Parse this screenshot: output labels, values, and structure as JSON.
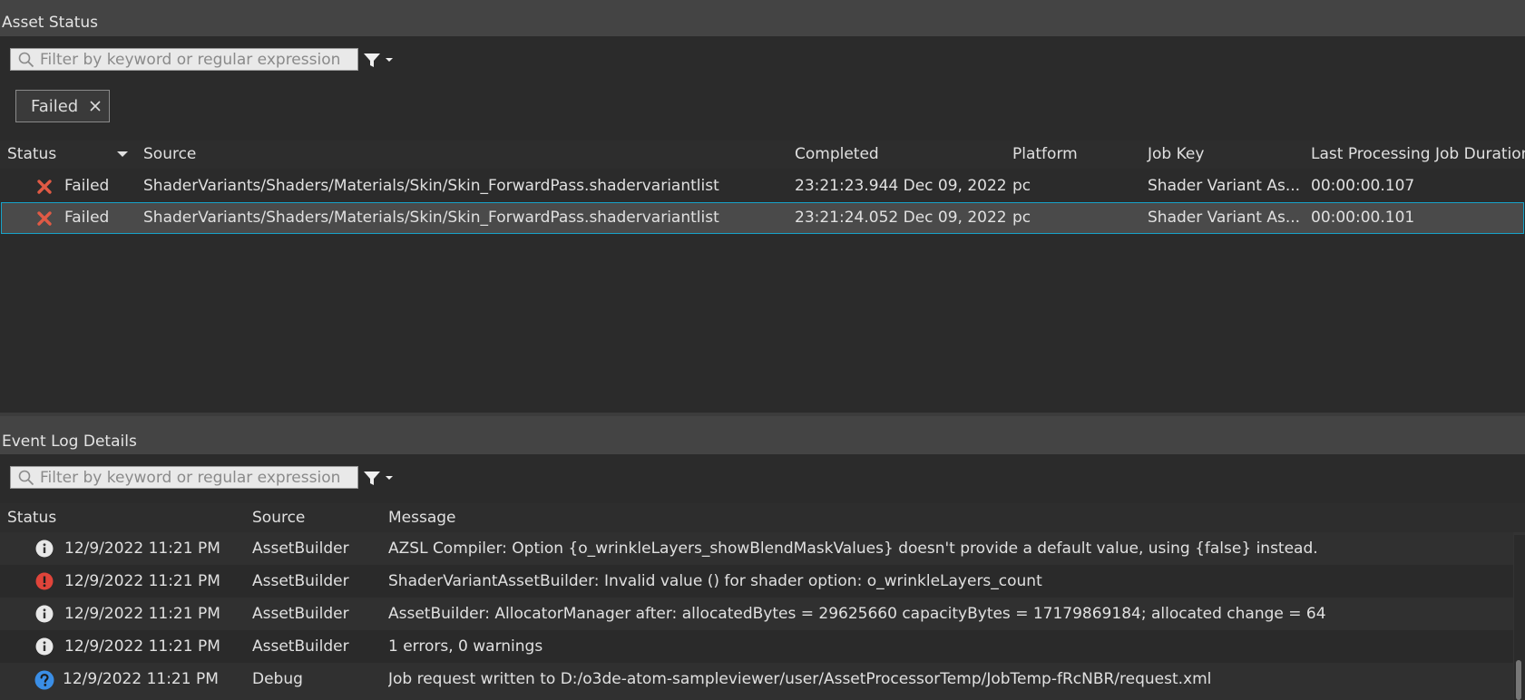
{
  "asset_status": {
    "title": "Asset Status",
    "search_placeholder": "Filter by keyword or regular expression",
    "filter_chip": "Failed",
    "columns": [
      "Status",
      "Source",
      "Completed",
      "Platform",
      "Job Key",
      "Last Processing Job Duration"
    ],
    "rows": [
      {
        "status": "Failed",
        "source": "ShaderVariants/Shaders/Materials/Skin/Skin_ForwardPass.shadervariantlist",
        "completed": "23:21:23.944 Dec 09, 2022",
        "platform": "pc",
        "job_key": "Shader Variant As...",
        "duration": "00:00:00.107"
      },
      {
        "status": "Failed",
        "source": "ShaderVariants/Shaders/Materials/Skin/Skin_ForwardPass.shadervariantlist",
        "completed": "23:21:24.052 Dec 09, 2022",
        "platform": "pc",
        "job_key": "Shader Variant As...",
        "duration": "00:00:00.101"
      }
    ]
  },
  "event_log": {
    "title": "Event Log Details",
    "search_placeholder": "Filter by keyword or regular expression",
    "columns": [
      "Status",
      "Source",
      "Message"
    ],
    "rows": [
      {
        "icon": "info-icon",
        "status": "12/9/2022 11:21 PM",
        "source": "AssetBuilder",
        "message": "AZSL Compiler: Option {o_wrinkleLayers_showBlendMaskValues} doesn't provide a default value, using {false} instead."
      },
      {
        "icon": "error-icon",
        "status": "12/9/2022 11:21 PM",
        "source": "AssetBuilder",
        "message": "ShaderVariantAssetBuilder: Invalid value () for shader option: o_wrinkleLayers_count"
      },
      {
        "icon": "info-icon",
        "status": "12/9/2022 11:21 PM",
        "source": "AssetBuilder",
        "message": "AssetBuilder: AllocatorManager after: allocatedBytes = 29625660 capacityBytes = 17179869184; allocated change = 64"
      },
      {
        "icon": "info-icon",
        "status": "12/9/2022 11:21 PM",
        "source": "AssetBuilder",
        "message": "1 errors, 0 warnings"
      },
      {
        "icon": "debug-icon",
        "status": "12/9/2022 11:21 PM",
        "source": "Debug",
        "message": "Job request written to D:/o3de-atom-sampleviewer/user/AssetProcessorTemp/JobTemp-fRcNBR/request.xml"
      }
    ]
  },
  "colors": {
    "failed": "#e05a45",
    "info": "#e8e8e8",
    "error": "#e0443a",
    "debug": "#3a8ee6",
    "selection_border": "#17a2c8"
  }
}
